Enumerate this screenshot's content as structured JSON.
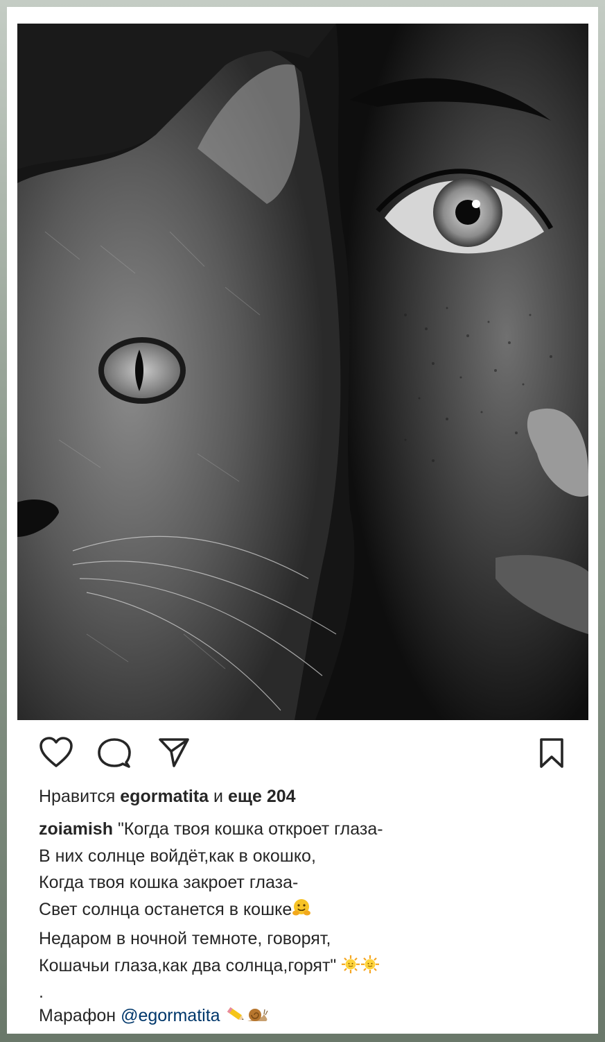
{
  "post": {
    "likes": {
      "prefix": "Нравится",
      "user": "egormatita",
      "middle": "и",
      "count_text": "еще 204"
    },
    "caption": {
      "username": "zoiamish",
      "lines": [
        "\"Когда твоя кошка откроет глаза-",
        "В них солнце войдёт,как в окошко,",
        "Когда твоя кошка закроет глаза-",
        "Свет солнца останется в кошке",
        "Недаром в ночной темноте, говорят,",
        "Кошачьи глаза,как два солнца,горят\""
      ],
      "separator": ".",
      "marathon_label": "Марафон",
      "mention": "@egormatita"
    },
    "icons": {
      "like": "heart-icon",
      "comment": "comment-bubble-icon",
      "share": "paper-plane-icon",
      "save": "bookmark-icon",
      "hug_emoji": "hugging-face-emoji",
      "sun_emoji": "sun-emoji",
      "pencil_emoji": "pencil-emoji",
      "snail_emoji": "snail-emoji"
    },
    "image": {
      "subject": "pencil drawing: half cat face, half woman face"
    }
  }
}
